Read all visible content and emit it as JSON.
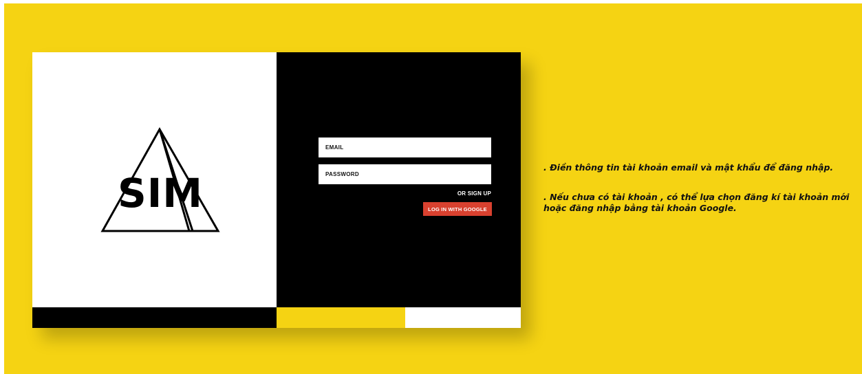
{
  "colors": {
    "background": "#f5d313",
    "panel_left": "#ffffff",
    "panel_right": "#000000",
    "google_button": "#d9412f"
  },
  "logo": {
    "text": "SIM",
    "icon": "triangle-logo-icon"
  },
  "login_form": {
    "email_placeholder": "EMAIL",
    "password_placeholder": "PASSWORD",
    "signup_label": "OR SIGN UP",
    "google_button_label": "LOG IN WITH GOOGLE"
  },
  "instructions": {
    "line1": ". Điền thông tin tài khoản email và mật khẩu để đăng nhập.",
    "line2": ". Nếu chưa có tài khoản , có thể lựa chọn đăng kí tài khoản mới hoặc đăng nhập bằng tài khoản Google."
  }
}
